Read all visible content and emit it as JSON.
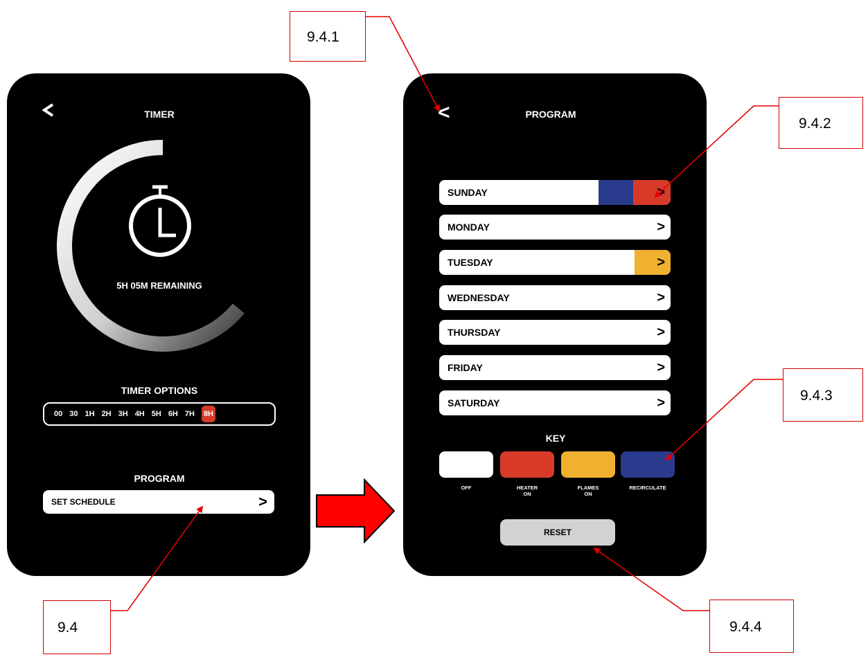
{
  "timer_screen": {
    "title": "TIMER",
    "back_icon": "chevron-left-icon",
    "remaining": "5H 05M REMAINING",
    "progress_fraction": 0.64,
    "timer_options_title": "TIMER OPTIONS",
    "options": [
      "00",
      "30",
      "1H",
      "2H",
      "3H",
      "4H",
      "5H",
      "6H",
      "7H",
      "8H"
    ],
    "selected_option": "8H",
    "program_title": "PROGRAM",
    "set_schedule_label": "SET SCHEDULE",
    "set_schedule_chevron": ">"
  },
  "program_screen": {
    "title": "PROGRAM",
    "back_label": "<",
    "days": [
      {
        "label": "SUNDAY",
        "chevron": ">"
      },
      {
        "label": "MONDAY",
        "chevron": ">"
      },
      {
        "label": "TUESDAY",
        "chevron": ">"
      },
      {
        "label": "WEDNESDAY",
        "chevron": ">"
      },
      {
        "label": "THURSDAY",
        "chevron": ">"
      },
      {
        "label": "FRIDAY",
        "chevron": ">"
      },
      {
        "label": "SATURDAY",
        "chevron": ">"
      }
    ],
    "key_title": "KEY",
    "key": [
      {
        "label_line1": "OFF",
        "label_line2": "",
        "color": "#ffffff"
      },
      {
        "label_line1": "HEATER",
        "label_line2": "ON",
        "color": "#d83a2a"
      },
      {
        "label_line1": "FLAMES",
        "label_line2": "ON",
        "color": "#f0b030"
      },
      {
        "label_line1": "RECIRCULATE",
        "label_line2": "",
        "color": "#2a3a8c"
      }
    ],
    "reset_label": "RESET"
  },
  "callouts": {
    "c1": "9.4.1",
    "c2": "9.4.2",
    "c3": "9.4.3",
    "c4": "9.4.4",
    "c5": "9.4"
  },
  "colors": {
    "heater": "#d83a2a",
    "flames": "#f0b030",
    "recirculate": "#2a3a8c",
    "annotation": "#ff0000"
  }
}
